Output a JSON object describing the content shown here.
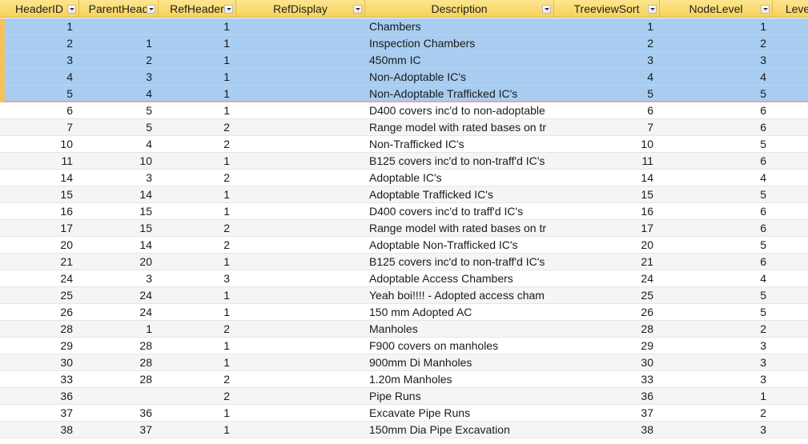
{
  "columns": [
    {
      "key": "header_id",
      "label": "HeaderID"
    },
    {
      "key": "parent_head",
      "label": "ParentHead"
    },
    {
      "key": "ref_header",
      "label": "RefHeader"
    },
    {
      "key": "ref_display",
      "label": "RefDisplay"
    },
    {
      "key": "description",
      "label": "Description"
    },
    {
      "key": "treeview_sort",
      "label": "TreeviewSort"
    },
    {
      "key": "node_level",
      "label": "NodeLevel"
    },
    {
      "key": "level_id",
      "label": "LevelI"
    }
  ],
  "rows": [
    {
      "header_id": "1",
      "parent_head": "",
      "ref_header": "1",
      "ref_display": "",
      "description": "Chambers",
      "treeview_sort": "1",
      "node_level": "1",
      "selected": true
    },
    {
      "header_id": "2",
      "parent_head": "1",
      "ref_header": "1",
      "ref_display": "",
      "description": "Inspection Chambers",
      "treeview_sort": "2",
      "node_level": "2",
      "selected": true
    },
    {
      "header_id": "3",
      "parent_head": "2",
      "ref_header": "1",
      "ref_display": "",
      "description": "450mm IC",
      "treeview_sort": "3",
      "node_level": "3",
      "selected": true
    },
    {
      "header_id": "4",
      "parent_head": "3",
      "ref_header": "1",
      "ref_display": "",
      "description": "Non-Adoptable IC's",
      "treeview_sort": "4",
      "node_level": "4",
      "selected": true
    },
    {
      "header_id": "5",
      "parent_head": "4",
      "ref_header": "1",
      "ref_display": "",
      "description": "Non-Adoptable Trafficked IC's",
      "treeview_sort": "5",
      "node_level": "5",
      "selected": true
    },
    {
      "header_id": "6",
      "parent_head": "5",
      "ref_header": "1",
      "ref_display": "",
      "description": "D400 covers inc'd to non-adoptable",
      "treeview_sort": "6",
      "node_level": "6",
      "selected": false
    },
    {
      "header_id": "7",
      "parent_head": "5",
      "ref_header": "2",
      "ref_display": "",
      "description": "Range model with rated bases on tr",
      "treeview_sort": "7",
      "node_level": "6",
      "selected": false
    },
    {
      "header_id": "10",
      "parent_head": "4",
      "ref_header": "2",
      "ref_display": "",
      "description": "Non-Trafficked IC's",
      "treeview_sort": "10",
      "node_level": "5",
      "selected": false
    },
    {
      "header_id": "11",
      "parent_head": "10",
      "ref_header": "1",
      "ref_display": "",
      "description": "B125 covers inc'd to non-traff'd IC's",
      "treeview_sort": "11",
      "node_level": "6",
      "selected": false
    },
    {
      "header_id": "14",
      "parent_head": "3",
      "ref_header": "2",
      "ref_display": "",
      "description": "Adoptable IC's",
      "treeview_sort": "14",
      "node_level": "4",
      "selected": false
    },
    {
      "header_id": "15",
      "parent_head": "14",
      "ref_header": "1",
      "ref_display": "",
      "description": "Adoptable Trafficked IC's",
      "treeview_sort": "15",
      "node_level": "5",
      "selected": false
    },
    {
      "header_id": "16",
      "parent_head": "15",
      "ref_header": "1",
      "ref_display": "",
      "description": "D400 covers inc'd to traff'd IC's",
      "treeview_sort": "16",
      "node_level": "6",
      "selected": false
    },
    {
      "header_id": "17",
      "parent_head": "15",
      "ref_header": "2",
      "ref_display": "",
      "description": "Range model with rated bases on tr",
      "treeview_sort": "17",
      "node_level": "6",
      "selected": false
    },
    {
      "header_id": "20",
      "parent_head": "14",
      "ref_header": "2",
      "ref_display": "",
      "description": "Adoptable Non-Trafficked IC's",
      "treeview_sort": "20",
      "node_level": "5",
      "selected": false
    },
    {
      "header_id": "21",
      "parent_head": "20",
      "ref_header": "1",
      "ref_display": "",
      "description": "B125 covers inc'd to non-traff'd IC's",
      "treeview_sort": "21",
      "node_level": "6",
      "selected": false
    },
    {
      "header_id": "24",
      "parent_head": "3",
      "ref_header": "3",
      "ref_display": "",
      "description": "Adoptable Access Chambers",
      "treeview_sort": "24",
      "node_level": "4",
      "selected": false
    },
    {
      "header_id": "25",
      "parent_head": "24",
      "ref_header": "1",
      "ref_display": "",
      "description": "Yeah boi!!!! - Adopted access cham",
      "treeview_sort": "25",
      "node_level": "5",
      "selected": false
    },
    {
      "header_id": "26",
      "parent_head": "24",
      "ref_header": "1",
      "ref_display": "",
      "description": "150 mm Adopted AC",
      "treeview_sort": "26",
      "node_level": "5",
      "selected": false
    },
    {
      "header_id": "28",
      "parent_head": "1",
      "ref_header": "2",
      "ref_display": "",
      "description": "Manholes",
      "treeview_sort": "28",
      "node_level": "2",
      "selected": false
    },
    {
      "header_id": "29",
      "parent_head": "28",
      "ref_header": "1",
      "ref_display": "",
      "description": "F900 covers on manholes",
      "treeview_sort": "29",
      "node_level": "3",
      "selected": false
    },
    {
      "header_id": "30",
      "parent_head": "28",
      "ref_header": "1",
      "ref_display": "",
      "description": "900mm Di Manholes",
      "treeview_sort": "30",
      "node_level": "3",
      "selected": false
    },
    {
      "header_id": "33",
      "parent_head": "28",
      "ref_header": "2",
      "ref_display": "",
      "description": "1.20m Manholes",
      "treeview_sort": "33",
      "node_level": "3",
      "selected": false
    },
    {
      "header_id": "36",
      "parent_head": "",
      "ref_header": "2",
      "ref_display": "",
      "description": "Pipe Runs",
      "treeview_sort": "36",
      "node_level": "1",
      "selected": false
    },
    {
      "header_id": "37",
      "parent_head": "36",
      "ref_header": "1",
      "ref_display": "",
      "description": "Excavate Pipe Runs",
      "treeview_sort": "37",
      "node_level": "2",
      "selected": false
    },
    {
      "header_id": "38",
      "parent_head": "37",
      "ref_header": "1",
      "ref_display": "",
      "description": "150mm Dia Pipe Excavation",
      "treeview_sort": "38",
      "node_level": "3",
      "selected": false
    }
  ]
}
